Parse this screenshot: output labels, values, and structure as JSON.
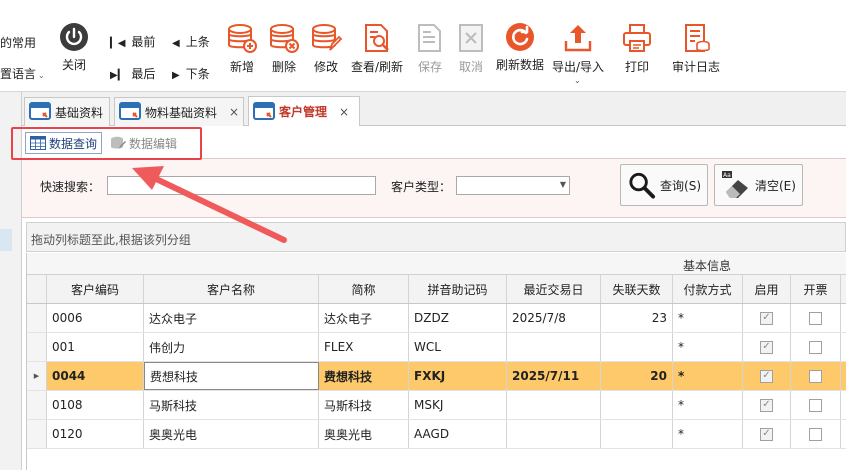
{
  "toolbar": {
    "left_partial_top": "的常用",
    "left_partial_bottom": "置语言",
    "close_label": "关闭",
    "nav_first": "最前",
    "nav_last": "最后",
    "nav_prev": "上条",
    "nav_next": "下条",
    "buttons": [
      {
        "label": "新增",
        "icon": "database-add-icon"
      },
      {
        "label": "删除",
        "icon": "database-delete-icon"
      },
      {
        "label": "修改",
        "icon": "database-edit-icon"
      },
      {
        "label": "查看/刷新",
        "icon": "document-search-icon"
      },
      {
        "label": "保存",
        "icon": "save-icon",
        "disabled": true
      },
      {
        "label": "取消",
        "icon": "cancel-icon",
        "disabled": true
      },
      {
        "label": "刷新数据",
        "icon": "refresh-icon"
      },
      {
        "label": "导出/导入",
        "icon": "export-icon"
      },
      {
        "label": "打印",
        "icon": "printer-icon"
      },
      {
        "label": "审计日志",
        "icon": "audit-log-icon"
      }
    ],
    "accent_color": "#e8562a"
  },
  "tabs": [
    {
      "label": "基础资料",
      "active": false,
      "closable": false
    },
    {
      "label": "物料基础资料",
      "active": false,
      "closable": true
    },
    {
      "label": "客户管理",
      "active": true,
      "closable": true
    }
  ],
  "tab_close_glyph": "×",
  "subtabs": [
    {
      "label": "数据查询",
      "active": true
    },
    {
      "label": "数据编辑",
      "active": false
    }
  ],
  "search": {
    "quick_label": "快速搜索：",
    "quick_value": "",
    "type_label": "客户类型：",
    "type_value": "",
    "query_button": "查询(S)",
    "clear_button": "清空(E)"
  },
  "group_panel_text": "拖动列标题至此,根据该列分组",
  "grid": {
    "band_label": "基本信息",
    "columns": [
      "客户编码",
      "客户名称",
      "简称",
      "拼音助记码",
      "最近交易日",
      "失联天数",
      "付款方式",
      "启用",
      "开票"
    ],
    "rows": [
      {
        "code": "0006",
        "name": "达众电子",
        "short": "达众电子",
        "pinyin": "DZDZ",
        "last_date": "2025/7/8",
        "lost_days": "23",
        "payment": "*",
        "enabled": true,
        "invoice": false,
        "selected": false
      },
      {
        "code": "001",
        "name": "伟创力",
        "short": "FLEX",
        "pinyin": "WCL",
        "last_date": "",
        "lost_days": "",
        "payment": "*",
        "enabled": true,
        "invoice": false,
        "selected": false
      },
      {
        "code": "0044",
        "name": "费想科技",
        "short": "费想科技",
        "pinyin": "FXKJ",
        "last_date": "2025/7/11",
        "lost_days": "20",
        "payment": "*",
        "enabled": true,
        "invoice": false,
        "selected": true
      },
      {
        "code": "0108",
        "name": "马斯科技",
        "short": "马斯科技",
        "pinyin": "MSKJ",
        "last_date": "",
        "lost_days": "",
        "payment": "*",
        "enabled": true,
        "invoice": false,
        "selected": false
      },
      {
        "code": "0120",
        "name": "奥奥光电",
        "short": "奥奥光电",
        "pinyin": "AAGD",
        "last_date": "",
        "lost_days": "",
        "payment": "*",
        "enabled": true,
        "invoice": false,
        "selected": false
      }
    ],
    "selected_row_color": "#fec96a"
  },
  "annotation": {
    "color": "#e9424a"
  }
}
